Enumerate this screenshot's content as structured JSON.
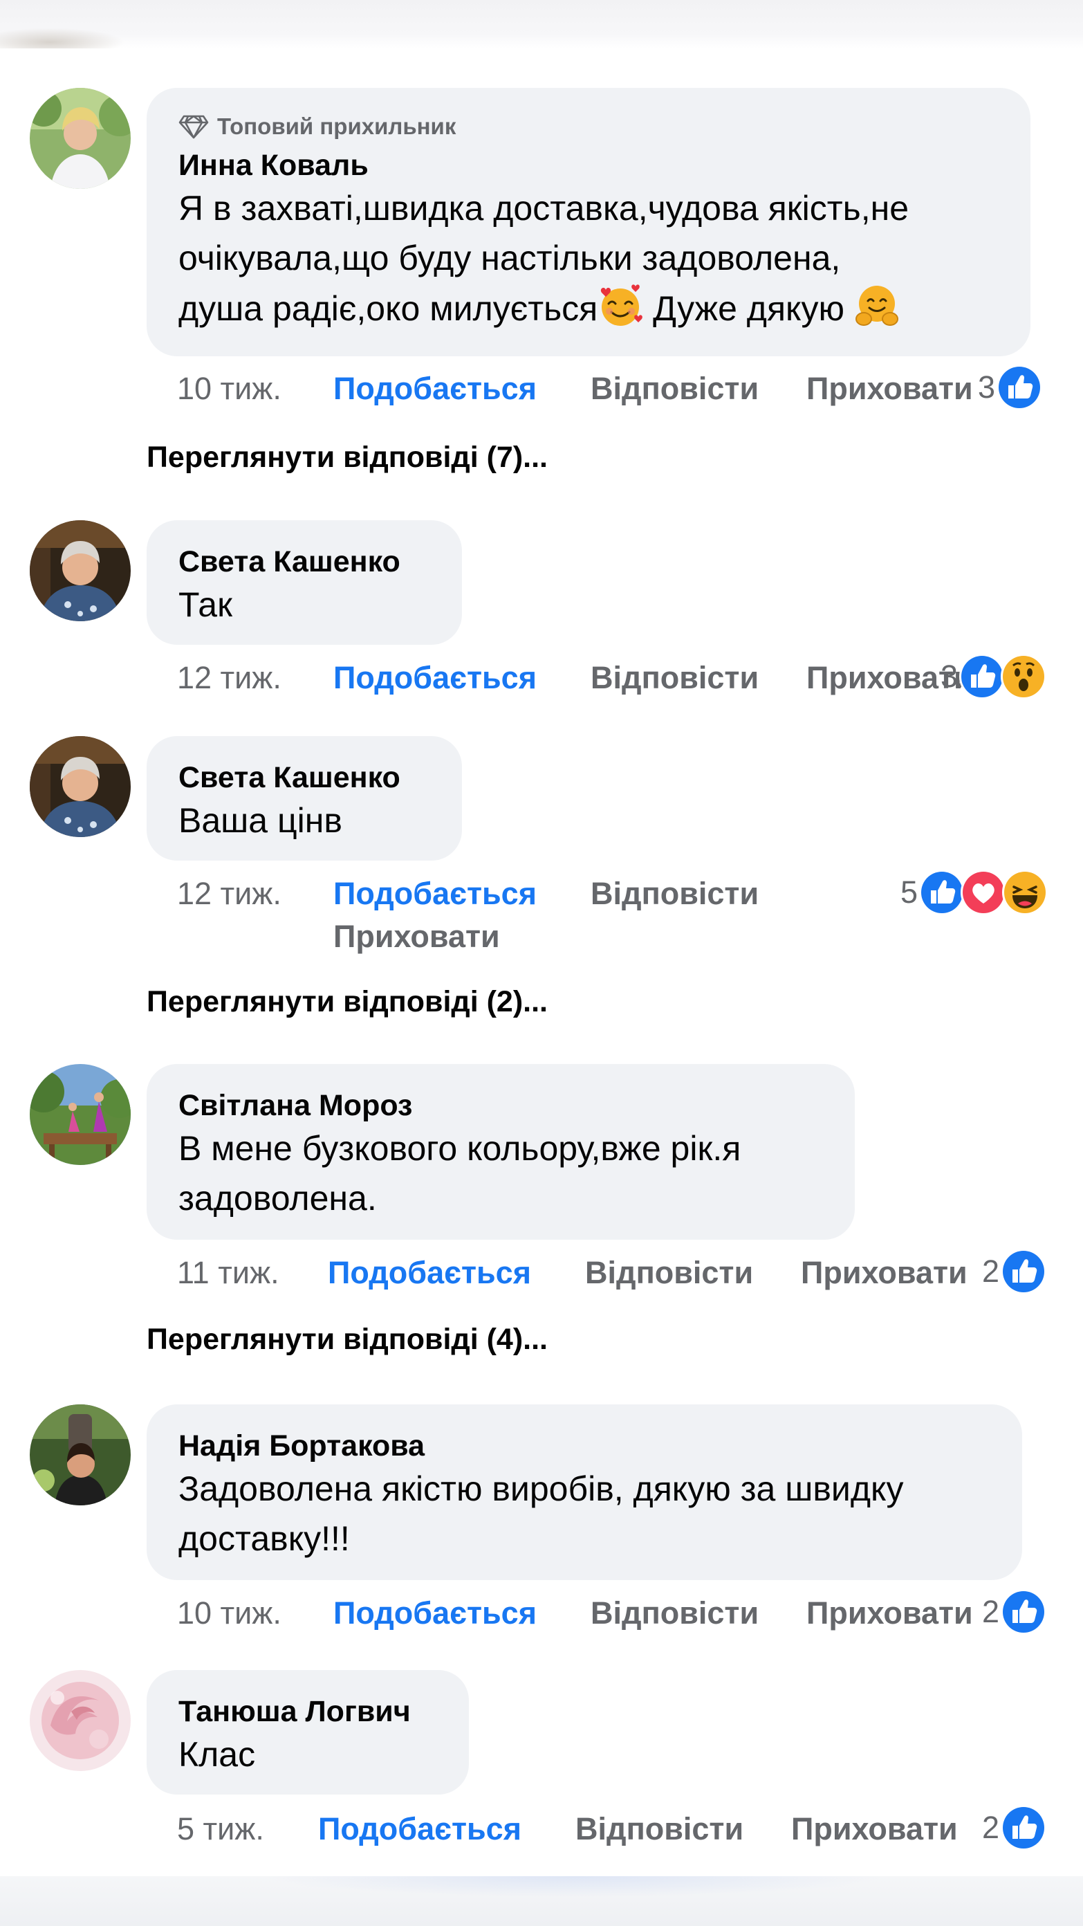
{
  "actions": {
    "like": "Подобається",
    "reply": "Відповісти",
    "hide": "Приховати"
  },
  "colors": {
    "accent": "#1877f2",
    "bubble": "#f0f2f5",
    "secondary_text": "#65676b",
    "love": "#f33e58",
    "emoji_yellow": "#f7b125"
  },
  "comments": [
    {
      "badge": "Топовий прихильник",
      "badge_icon": "diamond-icon",
      "author": "Инна Коваль",
      "text_lines": [
        "Я в захваті,швидка доставка,чудова якість,не",
        "очікувала,що буду настільки задоволена,"
      ],
      "text_last_a": "душа радіє,око милується",
      "text_last_b": " Дуже дякую ",
      "emoji_1": "smiling-face-with-hearts-emoji",
      "emoji_2": "hugging-face-emoji",
      "time": "10 тиж.",
      "reaction_count": "3",
      "reactions": [
        "like"
      ]
    },
    {
      "author": "Света Кашенко",
      "text": "Так",
      "time": "12 тиж.",
      "reaction_count": "3",
      "reactions": [
        "like",
        "wow"
      ]
    },
    {
      "author": "Света Кашенко",
      "text": "Ваша цінв",
      "time": "12 тиж.",
      "reaction_count": "5",
      "reactions": [
        "like",
        "love",
        "haha"
      ]
    },
    {
      "author": "Світлана Мороз",
      "text_lines": [
        "В мене бузкового кольору,вже рік.я",
        "задоволена."
      ],
      "time": "11 тиж.",
      "reaction_count": "2",
      "reactions": [
        "like"
      ]
    },
    {
      "author": "Надія Бортакова",
      "text_lines": [
        "Задоволена якістю виробів, дякую за швидку",
        "доставку!!!"
      ],
      "time": "10 тиж.",
      "reaction_count": "2",
      "reactions": [
        "like"
      ]
    },
    {
      "author": "Танюша Логвич",
      "text": "Клас",
      "time": "5 тиж.",
      "reaction_count": "2",
      "reactions": [
        "like"
      ]
    }
  ],
  "view_replies": [
    "Переглянути відповіді (7)...",
    "Переглянути відповіді (2)...",
    "Переглянути відповіді (4)..."
  ]
}
